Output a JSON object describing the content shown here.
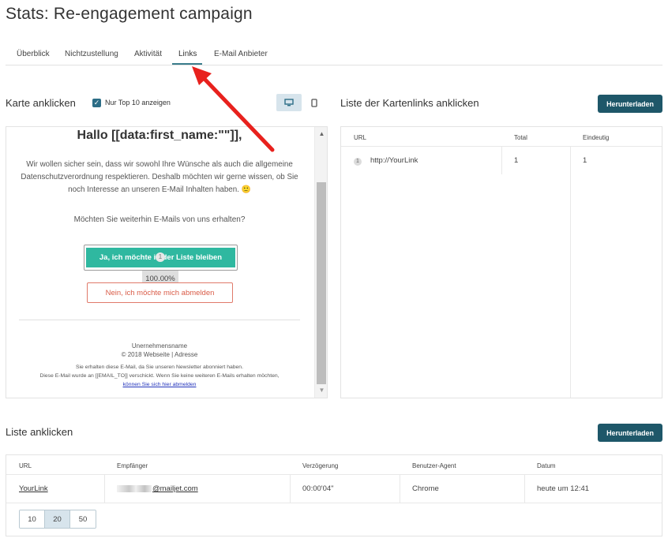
{
  "page": {
    "title": "Stats: Re-engagement campaign"
  },
  "tabs": [
    {
      "label": "Überblick"
    },
    {
      "label": "Nichtzustellung"
    },
    {
      "label": "Aktivität"
    },
    {
      "label": "Links",
      "active": true
    },
    {
      "label": "E-Mail Anbieter"
    }
  ],
  "map_section": {
    "title": "Karte anklicken",
    "top10_label": "Nur Top 10 anzeigen",
    "top10_checked": true,
    "view_mode": "desktop"
  },
  "email_preview": {
    "greeting": "Hallo [[data:first_name:\"\"]],",
    "body": "Wir wollen sicher sein, dass wir sowohl Ihre Wünsche als auch die allgemeine Datenschutzverordnung respektieren. Deshalb möchten wir gerne wissen, ob Sie noch Interesse an unseren E-Mail Inhalten haben. 🙂",
    "question": "Möchten Sie weiterhin E-Mails von uns erhalten?",
    "yes_button": "Ja, ich möchte in der Liste bleiben",
    "yes_click_badge": "1",
    "yes_click_percent": "100.00%",
    "no_button": "Nein, ich möchte mich abmelden",
    "footer": {
      "company": "Unernehmensname",
      "copyright": "© 2018 Webseite | Adresse",
      "notice1": "Sie erhalten diese E-Mail, da Sie unseren Newsletter abonniert haben.",
      "notice2": "Diese E-Mail wurde an [[EMAIL_TO]] verschickt. Wenn Sie keine weiteren E-Mails erhalten möchten,",
      "unsubscribe": "können Sie sich hier abmelden"
    }
  },
  "links_list": {
    "title": "Liste der Kartenlinks anklicken",
    "download_label": "Herunterladen",
    "headers": {
      "url": "URL",
      "total": "Total",
      "unique": "Eindeutig"
    },
    "rows": [
      {
        "index": "1",
        "url": "http://YourLink",
        "total": "1",
        "unique": "1"
      }
    ]
  },
  "clicks_list": {
    "title": "Liste anklicken",
    "download_label": "Herunterladen",
    "headers": {
      "url": "URL",
      "recipient": "Empfänger",
      "delay": "Verzögerung",
      "agent": "Benutzer-Agent",
      "date": "Datum"
    },
    "rows": [
      {
        "url": "YourLink",
        "recipient": "@mailjet.com",
        "delay": "00:00'04\"",
        "agent": "Chrome",
        "date": "heute um 12:41"
      }
    ],
    "page_sizes": [
      "10",
      "20",
      "50"
    ],
    "page_size_selected": "20"
  },
  "annotation": {
    "arrow_color": "#e8211d"
  }
}
